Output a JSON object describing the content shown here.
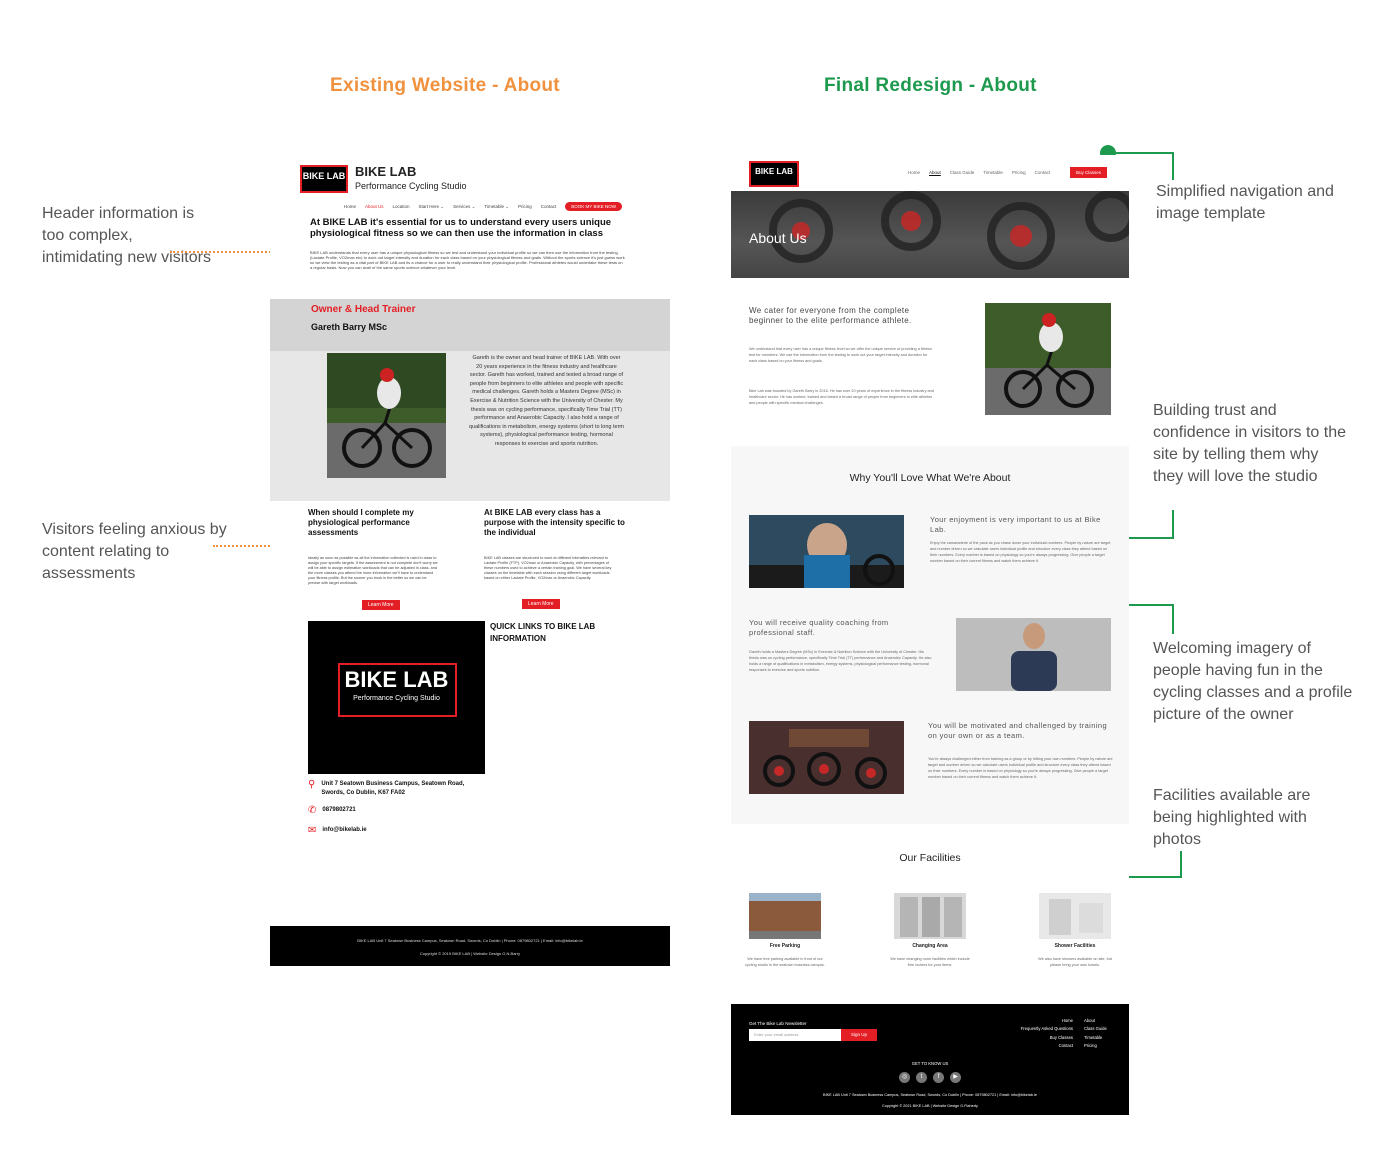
{
  "headings": {
    "existing": "Existing Website - About",
    "redesign": "Final Redesign - About"
  },
  "annotations": {
    "header_complex": "Header information is too complex, intimidating new visitors",
    "anxious": "Visitors feeling anxious by content relating to assessments",
    "simplified_nav": "Simplified navigation and image template",
    "building_trust": "Building trust and confidence in visitors to the site by telling them why they will love the studio",
    "welcoming": "Welcoming imagery of people having fun in the cycling classes and a profile picture of the owner",
    "facilities": "Facilities available are being highlighted with photos"
  },
  "colors": {
    "existing_accent": "#f0913d",
    "redesign_accent": "#1d9a4d",
    "brand_red": "#e31e24"
  },
  "old_site": {
    "logo": "BIKE LAB",
    "brand": "BIKE LAB",
    "tagline": "Performance Cycling Studio",
    "nav": [
      "Home",
      "About Us",
      "Location",
      "Start Here ⌄",
      "Services ⌄",
      "Timetable ⌄",
      "Pricing",
      "Contact"
    ],
    "book_button": "BOOK MY BIKE NOW",
    "intro_heading": "At BIKE LAB it's essential for us to understand every users unique physiological fitness so we can then use the information in class",
    "intro_text": "BIKE LAB understands that every user has a unique physiological fitness so we test and understand your individual profile so we can then use the information from the testing (Lactate Profile, VO2max etc) to work out target intensity and duration for each class based on your physiological fitness and goals. Without the sports science it's just guess work so we view the testing as a vital part of BIKE LAB and its a chance for a user to really understand their physiological profile. Professional athletes would undertake these tests on a regular basis. Now you can avail of the same sports science whatever your level.",
    "owner_title": "Owner & Head Trainer",
    "owner_name": "Gareth Barry MSc",
    "bio": "Gareth is the owner and head trainer of BIKE LAB. With over 20 years experience in the fitness industry and healthcare sector. Gareth has worked, trained and tested a broad range of people from beginners to elite athletes and people with specific medical challenges. Gareth holds a Masters Degree (MSc) in Exercise & Nutrition Science with the University of Chester. My thesis was on cycling performance, specifically Time Trial (TT) performance and Anaerobic Capacity. I also hold a range of qualifications in metabolism, energy systems (short to long term systems), physiological performance testing, hormonal responses to exercise and sports nutrition.",
    "q1": "When should I complete my physiological performance assessments",
    "q1_text": "Ideally as soon as possible as all the information collected is used in class to assign your specific targets. If the assessment is not complete don't worry we will be able to assign estimation workloads that can be adjusted in class, and the more classes you attend the more information we'll have to understand your fitness profile. But the sooner you book in the better so we can be precise with target workloads.",
    "q2": "At BIKE LAB every class has a purpose with the intensity specific to the individual",
    "q2_text": "BIKE LAB classes are structured to work at different intensities relevant to Lactate Profile (FTP), VO2max or Anaerobic Capacity, with percentages of these numbers used to achieve a certain training goal. We have several key classes on the timetable with each session using different target workloads based on either Lactate Profile, VO2max or Anaerobic Capacity.",
    "learn_more": "Learn More",
    "big_logo": "BIKE LAB",
    "big_logo_sub": "Performance Cycling Studio",
    "quick_links": "QUICK LINKS TO BIKE LAB INFORMATION",
    "address": "Unit 7 Seatown Business Campus, Seatown Road, Swords, Co Dublin, K67 FA02",
    "phone": "0879802721",
    "email": "info@bikelab.ie",
    "footer_address": "BIKE LAB Unit 7 Seatown Business Campus, Seatown Road, Swords, Co Dublin | Phone: 0879802721 | Email: info@bikelab.ie",
    "footer_copy": "Copyright © 2019 BIKE LAB | Website Design G.N.Barry"
  },
  "new_site": {
    "logo": "BIKE LAB",
    "nav": [
      "Home",
      "About",
      "Class Guide",
      "Timetable",
      "Pricing",
      "Contact"
    ],
    "buy_button": "Buy Classes",
    "hero_title": "About Us",
    "intro_heading": "We cater for everyone from the complete beginner to the elite performance athlete.",
    "intro_p1": "We understand that every user has a unique fitness level so we offer the unique service of providing a fitness test for members. We use the information from the testing to work out your target intensity and duration for each class based on your fitness and goals.",
    "intro_p2": "Bike Lab was founded by Gareth Barry in 2016. He has over 20 years of experience in the fitness industry and healthcare sector. He has worked, trained and tested a broad range of people from beginners to elite athletes and people with specific medical challenges.",
    "why_title": "Why You'll Love What We're About",
    "f1_heading": "Your enjoyment is very important to us at Bike Lab.",
    "f1_text": "Enjoy the camaraderie of the pack as you chase down your individual numbers. People by nature are target and number driven so we calculate users individual profile and structure every class they attend based on their numbers. Every number is based on physiology so you're always progressing. Give people a target number based on their current fitness and watch them achieve it.",
    "f2_heading": "You will receive quality coaching from professional staff.",
    "f2_text": "Gareth holds a Masters Degree (MSc) in Exercise & Nutrition Science with the University of Chester. His thesis was on cycling performance, specifically Time Trial (TT) performance and Anaerobic Capacity. He also holds a range of qualifications in metabolism, energy systems, physiological performance testing, hormonal responses to exercise and sports nutrition.",
    "f3_heading": "You will be motivated and challenged by training on your own or as a team.",
    "f3_text": "You're always challenged either from training as a group or by hitting your own numbers. People by nature are target and number driven so we calculate users individual profile and structure every class they attend based on their numbers. Every number is based on physiology so you're always progressing. Give people a target number based on their current fitness and watch them achieve it.",
    "facilities_title": "Our Facilities",
    "facilities": [
      {
        "name": "Free Parking",
        "desc": "We have free parking available in front of our cycling studio in the seatown business campus."
      },
      {
        "name": "Changing Area",
        "desc": "We have changing room facilities which include free lockers for your items."
      },
      {
        "name": "Shower Facilities",
        "desc": "We also have showers available on site, but please bring your own towels."
      }
    ],
    "footer": {
      "newsletter": "Get The Bike Lab Newsletter",
      "email_placeholder": "Enter your email address",
      "signup": "Sign Up",
      "links_left": [
        "Home",
        "Frequently Asked Questions",
        "Buy Classes",
        "Contact"
      ],
      "links_right": [
        "About",
        "Class Guide",
        "Timetable",
        "Pricing"
      ],
      "get_to_know": "GET TO KNOW US",
      "social": [
        "instagram-icon",
        "twitter-icon",
        "facebook-icon",
        "youtube-icon"
      ],
      "address": "BIKE LAB Unit 7 Seatown Business Campus, Seatown Road, Swords, Co Dublin | Phone: 0879802721 | Email: info@bikelab.ie",
      "copyright": "Copyright © 2021 BIKE LAB | Website Design G.Flaherty"
    }
  }
}
